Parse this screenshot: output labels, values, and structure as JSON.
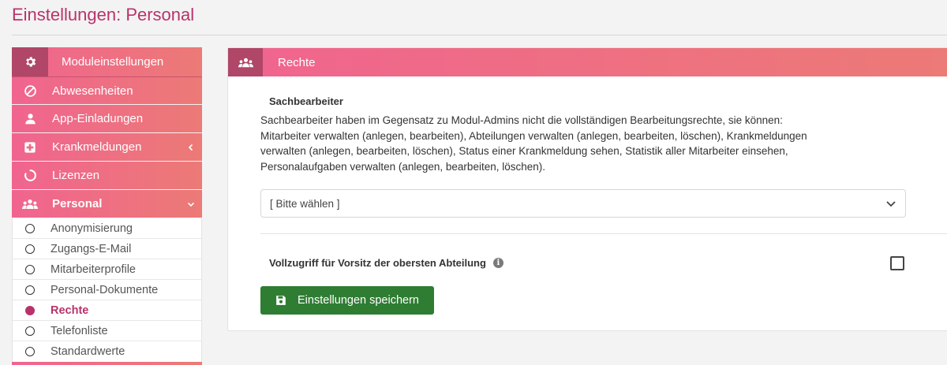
{
  "page": {
    "title": "Einstellungen: Personal"
  },
  "sidebar": {
    "header": {
      "label": "Moduleinstellungen",
      "icon": "gear-icon"
    },
    "items": [
      {
        "label": "Abwesenheiten",
        "icon": "ban-icon"
      },
      {
        "label": "App-Einladungen",
        "icon": "user-icon"
      },
      {
        "label": "Krankmeldungen",
        "icon": "medical-plus-icon",
        "chevron": "‹"
      },
      {
        "label": "Lizenzen",
        "icon": "circle-notch-icon"
      },
      {
        "label": "Personal",
        "icon": "users-icon",
        "chevron": "⌄"
      }
    ],
    "subitems": [
      {
        "label": "Anonymisierung"
      },
      {
        "label": "Zugangs-E-Mail"
      },
      {
        "label": "Mitarbeiterprofile"
      },
      {
        "label": "Personal-Dokumente"
      },
      {
        "label": "Rechte",
        "selected": true
      },
      {
        "label": "Telefonliste"
      },
      {
        "label": "Standardwerte"
      }
    ]
  },
  "panel": {
    "header": {
      "label": "Rechte",
      "icon": "users-icon"
    },
    "section_title": "Sachbearbeiter",
    "description": "Sachbearbeiter haben im Gegensatz zu Modul-Admins nicht die vollständigen Bearbeitungsrechte, sie können: Mitarbeiter verwalten (anlegen, bearbeiten), Abteilungen verwalten (anlegen, bearbeiten, löschen), Krankmeldungen verwalten (anlegen, bearbeiten, löschen), Status einer Krankmeldung sehen, Statistik aller Mitarbeiter einsehen, Personalaufgaben verwalten (anlegen, bearbeiten, löschen).",
    "select": {
      "value": "[ Bitte wählen ]"
    },
    "checkbox": {
      "label": "Vollzugriff für Vorsitz der obersten Abteilung",
      "checked": false,
      "info": "i"
    },
    "save_button": {
      "label": "Einstellungen speichern"
    }
  },
  "colors": {
    "accent": "#b8336a",
    "menu_gradient_start": "#f0648f",
    "menu_gradient_end": "#ec7a76",
    "icon_box": "#b04668",
    "save_button": "#2e7d32"
  }
}
